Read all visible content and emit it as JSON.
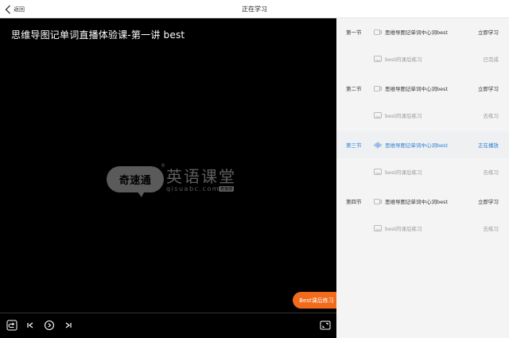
{
  "header": {
    "back_label": "返回",
    "title": "正在学习"
  },
  "player": {
    "video_title": "思维导图记单词直播体验课-第一讲 best",
    "watermark": {
      "brand_cn": "英语课堂",
      "brand_en": "qisuabc.com",
      "mascot_text": "奇速通",
      "badge": "奇速通",
      "reg": "®"
    },
    "practice_button_label": "Best课后练习",
    "controls": [
      "replay-icon",
      "previous-icon",
      "play-icon",
      "next-icon",
      "fullscreen-icon"
    ]
  },
  "lessons": [
    {
      "section": "第一节",
      "title": "思维导图记单词中心词best",
      "status": "立即学习",
      "exercise_title": "best的课后练习",
      "exercise_status": "已完成"
    },
    {
      "section": "第二节",
      "title": "思维导图记单词中心词best",
      "status": "立即学习",
      "exercise_title": "best的课后练习",
      "exercise_status": "去练习"
    },
    {
      "section": "第三节",
      "title": "思维导图记单词中心词best",
      "status": "正在播放",
      "exercise_title": "best的课后练习",
      "exercise_status": "去练习"
    },
    {
      "section": "第四节",
      "title": "思维导图记单词中心词best",
      "status": "立即学习",
      "exercise_title": "best的课后练习",
      "exercise_status": "去练习"
    }
  ],
  "colors": {
    "accent": "#2f7fd6",
    "practice_button": "#f26a1b",
    "player_bg": "#000000"
  }
}
